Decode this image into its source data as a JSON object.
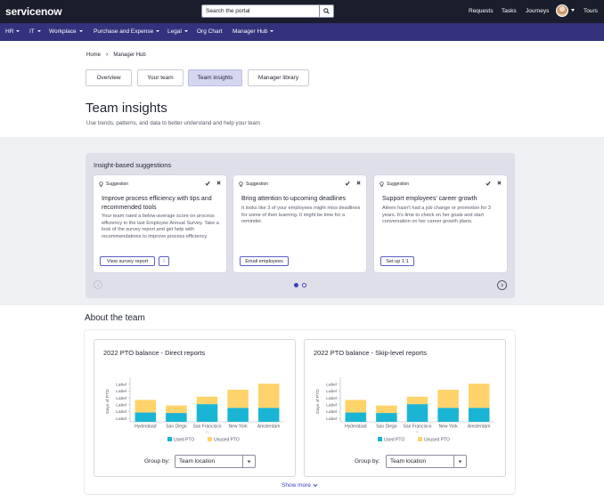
{
  "header": {
    "logo": "servicenow",
    "search_placeholder": "Search the portal",
    "links": [
      "Requests",
      "Tasks",
      "Journeys",
      "Tours"
    ]
  },
  "nav": {
    "items": [
      {
        "label": "HR",
        "caret": true
      },
      {
        "label": "IT",
        "caret": true
      },
      {
        "label": "Workplace",
        "caret": true
      },
      {
        "label": "Purchase and Expense",
        "caret": true
      },
      {
        "label": "Legal",
        "caret": true
      },
      {
        "label": "Org Chart",
        "caret": false
      },
      {
        "label": "Manager Hub",
        "caret": true
      }
    ]
  },
  "breadcrumb": {
    "home": "Home",
    "current": "Manager Hub"
  },
  "tabs": [
    {
      "label": "Overview",
      "active": false
    },
    {
      "label": "Your team",
      "active": false
    },
    {
      "label": "Team insights",
      "active": true
    },
    {
      "label": "Manager library",
      "active": false
    }
  ],
  "page": {
    "title": "Team insights",
    "subtitle": "Use trends, patterns, and data to better understand and help your team"
  },
  "insights": {
    "title": "Insight-based suggestions",
    "cards": [
      {
        "tag": "Suggestion",
        "title": "Improve process efficiency with tips and recommended tools",
        "body": "Your team rated a below-average score on process efficiency in the last Employee Annual Survey. Take a look of the survey report and get help with recommendations to improve process efficiency.",
        "button": "View survey report",
        "extra_button": "⁝"
      },
      {
        "tag": "Suggestion",
        "title": "Bring attention to upcoming deadlines",
        "body": "It looks like 3 of your employees might miss deadlines for some of their learning. It might be time for a reminder.",
        "button": "Email employees"
      },
      {
        "tag": "Suggestion",
        "title": "Support employees' career growth",
        "body": "Aileen hasn't had a job change or promotion for 3 years. It's time to check on her goals and start conversation on her career growth plans.",
        "button": "Set up 1:1"
      }
    ],
    "page_count": 2,
    "current_page": 1
  },
  "about": {
    "title": "About the team",
    "show_more": "Show more"
  },
  "colors": {
    "used": "#1ab5d4",
    "unused": "#ffd36b",
    "accent": "#32327d"
  },
  "chart_data": [
    {
      "type": "bar",
      "stacked": true,
      "title": "2022 PTO balance - Direct reports",
      "ylabel": "Days of PTO",
      "ytick_label": "Label",
      "categories": [
        "Hyderabad",
        "San Diego",
        "San Francisco",
        "New York",
        "Amsterdam"
      ],
      "category_sublabels": [
        "",
        "",
        "...",
        "",
        ""
      ],
      "series": [
        {
          "name": "Used PTO",
          "values": [
            2,
            1.9,
            3.8,
            3,
            3
          ]
        },
        {
          "name": "Unused PTO",
          "values": [
            2.7,
            1.6,
            1.6,
            3.9,
            5.2
          ]
        }
      ],
      "ylim": [
        0,
        8.8
      ],
      "group_by_label": "Group by:",
      "group_by_value": "Team location"
    },
    {
      "type": "bar",
      "stacked": true,
      "title": "2022 PTO balance - Skip-level reports",
      "ylabel": "Days of PTO",
      "ytick_label": "Label",
      "categories": [
        "Hyderabad",
        "San Diego",
        "San Francisco",
        "New York",
        "Amsterdam"
      ],
      "category_sublabels": [
        "",
        "",
        "...",
        "",
        ""
      ],
      "series": [
        {
          "name": "Used PTO",
          "values": [
            2,
            1.9,
            3.8,
            3,
            3
          ]
        },
        {
          "name": "Unused PTO",
          "values": [
            2.7,
            1.6,
            1.6,
            3.9,
            5.2
          ]
        }
      ],
      "ylim": [
        0,
        8.8
      ],
      "group_by_label": "Group by:",
      "group_by_value": "Team location"
    }
  ]
}
